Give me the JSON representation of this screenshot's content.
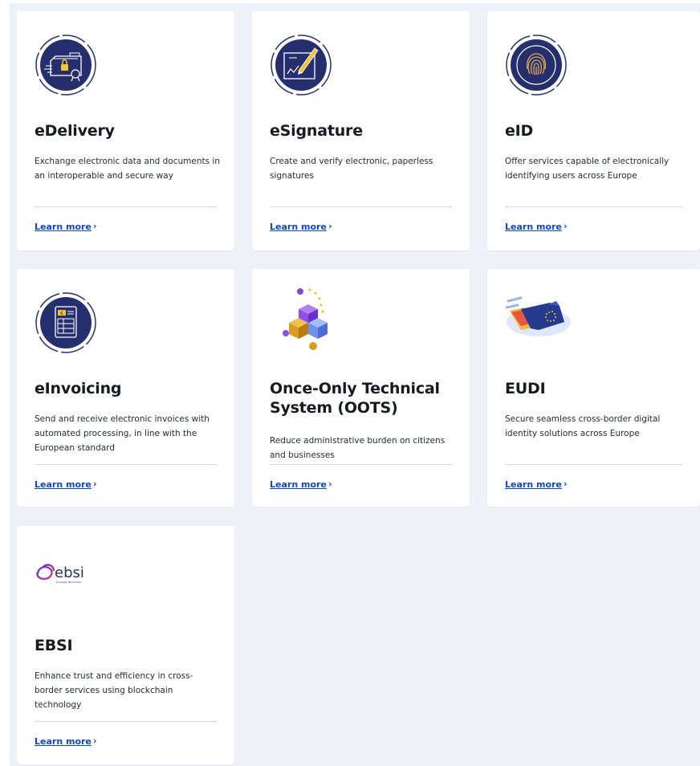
{
  "colors": {
    "navy": "#262f6e",
    "link": "#0e47cb",
    "panel": "#eef2f8",
    "gold": "#f3c331"
  },
  "cards": [
    {
      "title": "eDelivery",
      "description": "Exchange electronic data and documents in an interoperable and secure way",
      "link": "Learn more",
      "icon": "edelivery-icon"
    },
    {
      "title": "eSignature",
      "description": "Create and verify electronic, paperless signatures",
      "link": "Learn more",
      "icon": "esignature-icon"
    },
    {
      "title": "eID",
      "description": "Offer services capable of electronically identifying users across Europe",
      "link": "Learn more",
      "icon": "fingerprint-icon"
    },
    {
      "title": "eInvoicing",
      "description": "Send and receive electronic invoices with automated processing, in line with the European standard",
      "link": "Learn more",
      "icon": "invoice-icon"
    },
    {
      "title": "Once-Only Technical System (OOTS)",
      "description": "Reduce administrative burden on citizens and businesses",
      "link": "Learn more",
      "icon": "cubes-icon"
    },
    {
      "title": "EUDI",
      "description": "Secure seamless cross-border digital identity solutions across Europe",
      "link": "Learn more",
      "icon": "eu-wallet-icon"
    },
    {
      "title": "EBSI",
      "description": "Enhance trust and efficiency in cross-border services using blockchain technology",
      "link": "Learn more",
      "icon": "ebsi-logo-icon",
      "logo_text": "ebsi",
      "logo_subtext": "European Blockchain"
    }
  ]
}
